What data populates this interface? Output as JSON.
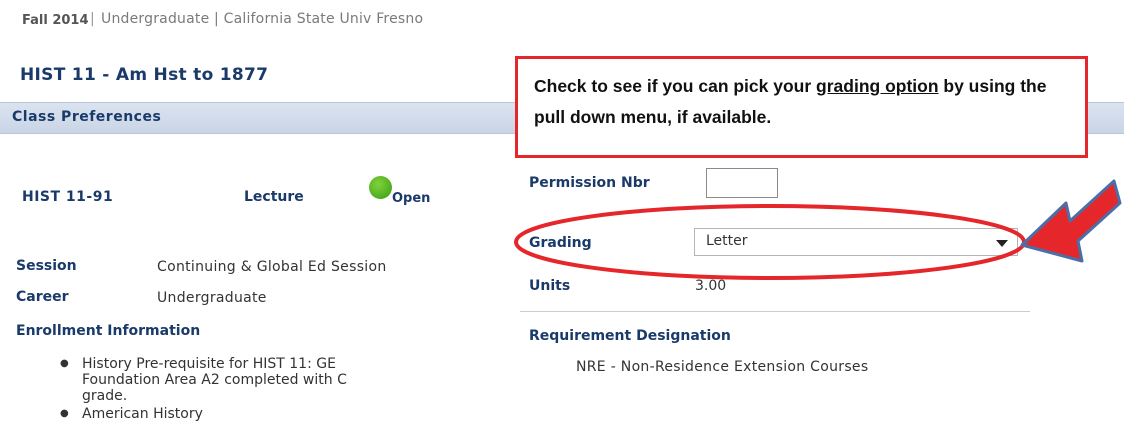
{
  "header": {
    "term": "Fall 2014",
    "separator": "|",
    "career_institution": "Undergraduate | California State Univ  Fresno"
  },
  "class": {
    "title": "HIST  11 - Am Hst to 1877",
    "section": "HIST  11-91",
    "component": "Lecture",
    "status": "Open"
  },
  "preferences": {
    "header": "Class Preferences",
    "session_label": "Session",
    "session_value": "Continuing & Global Ed Session",
    "career_label": "Career",
    "career_value": "Undergraduate",
    "enrollment_label": "Enrollment Information",
    "enrollment_items": [
      "History Pre-requisite for HIST 11: GE Foundation Area A2 completed with C grade.",
      "American History"
    ],
    "permission_label": "Permission Nbr",
    "permission_value": "",
    "grading_label": "Grading",
    "grading_value": "Letter",
    "units_label": "Units",
    "units_value": "3.00",
    "requirement_label": "Requirement Designation",
    "requirement_value": "NRE - Non-Residence Extension Courses"
  },
  "annotation": {
    "text_before": "Check to see if you can pick your ",
    "text_underlined": "grading option",
    "text_after": " by using the pull down menu, if available.",
    "color": "#e5262a",
    "arrow_color": "#e5262a",
    "arrow_outline": "#4a6fa8"
  },
  "icons": {
    "open_status": "green-circle-icon",
    "dropdown": "caret-down-icon",
    "pointer": "red-arrow-icon"
  },
  "colors": {
    "label_blue": "#1a3a6a",
    "status_green": "#4fb020",
    "header_band": "#d2dcea"
  }
}
